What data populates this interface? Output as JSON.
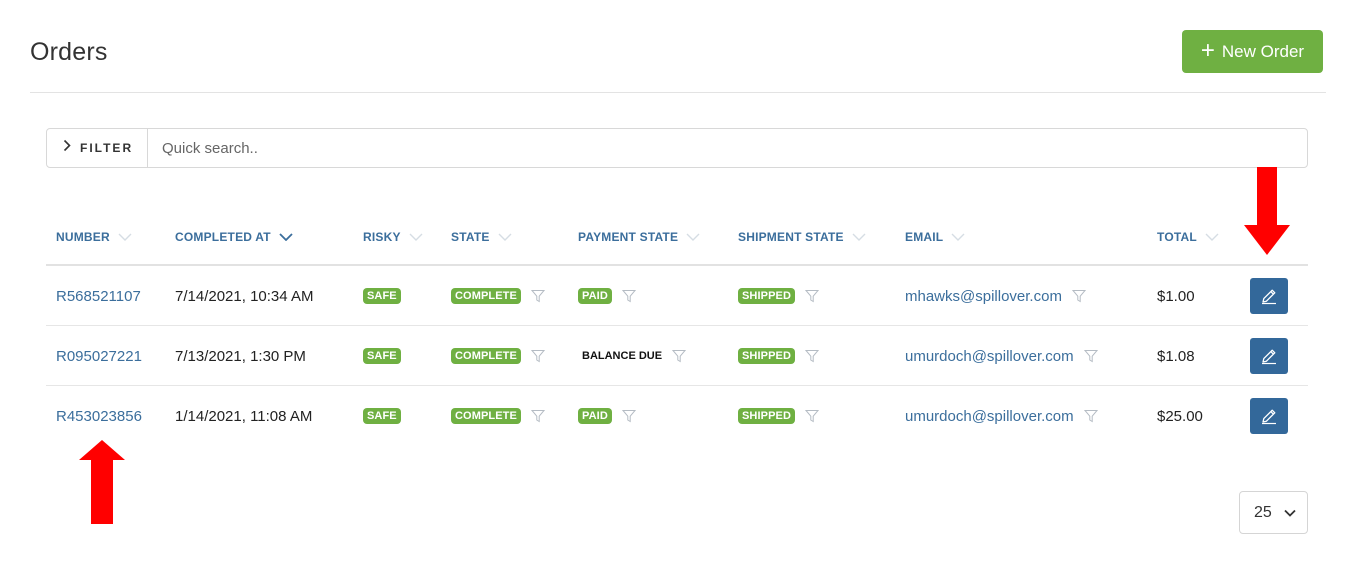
{
  "header": {
    "title": "Orders",
    "new_order_label": "New Order"
  },
  "filter": {
    "toggle_label": "FILTER",
    "search_placeholder": "Quick search.."
  },
  "columns": {
    "number": "NUMBER",
    "completed_at": "COMPLETED AT",
    "risky": "RISKY",
    "state": "STATE",
    "payment_state": "PAYMENT STATE",
    "shipment_state": "SHIPMENT STATE",
    "email": "EMAIL",
    "total": "TOTAL"
  },
  "rows": [
    {
      "number": "R568521107",
      "completed_at": "7/14/2021, 10:34 AM",
      "risky": "SAFE",
      "state": "COMPLETE",
      "payment_state": "PAID",
      "shipment_state": "SHIPPED",
      "email": "mhawks@spillover.com",
      "total": "$1.00"
    },
    {
      "number": "R095027221",
      "completed_at": "7/13/2021, 1:30 PM",
      "risky": "SAFE",
      "state": "COMPLETE",
      "payment_state": "BALANCE DUE",
      "shipment_state": "SHIPPED",
      "email": "umurdoch@spillover.com",
      "total": "$1.08"
    },
    {
      "number": "R453023856",
      "completed_at": "1/14/2021, 11:08 AM",
      "risky": "SAFE",
      "state": "COMPLETE",
      "payment_state": "PAID",
      "shipment_state": "SHIPPED",
      "email": "umurdoch@spillover.com",
      "total": "$25.00"
    }
  ],
  "pagination": {
    "per_page": "25"
  },
  "colors": {
    "accent_green": "#6fb042",
    "link_blue": "#3b6e9c",
    "edit_blue": "#33689a",
    "annotation_red": "#ff0000"
  },
  "icons": [
    "plus-icon",
    "chevron-right-icon",
    "chevron-down-icon",
    "funnel-filter-icon",
    "pencil-edit-icon",
    "red-arrow-annotation"
  ]
}
